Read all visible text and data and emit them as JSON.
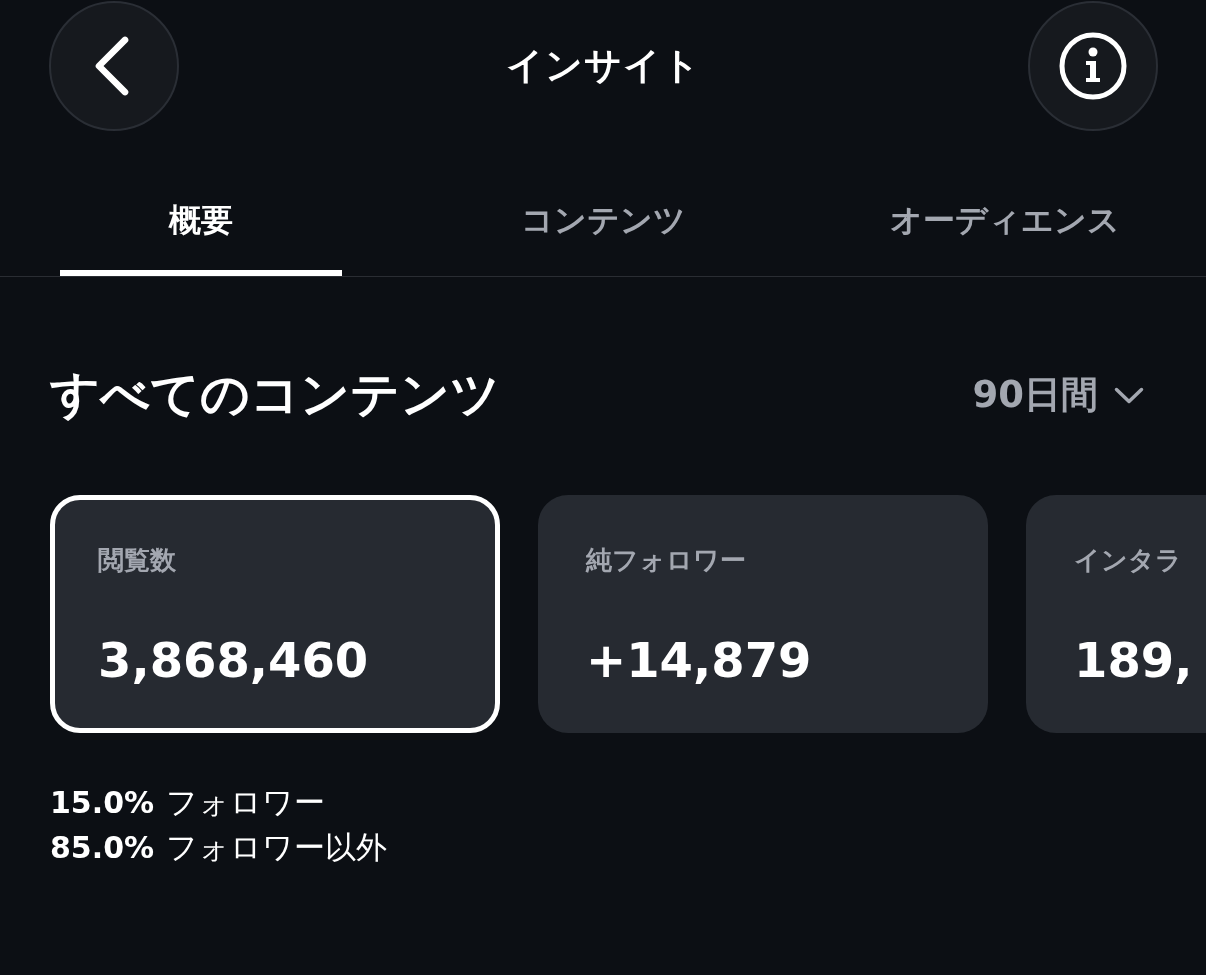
{
  "header": {
    "title": "インサイト"
  },
  "tabs": [
    {
      "label": "概要",
      "selected": true
    },
    {
      "label": "コンテンツ",
      "selected": false
    },
    {
      "label": "オーディエンス",
      "selected": false
    }
  ],
  "section": {
    "title": "すべてのコンテンツ",
    "period": "90日間"
  },
  "metrics": [
    {
      "label": "閲覧数",
      "value": "3,868,460",
      "selected": true
    },
    {
      "label": "純フォロワー",
      "value": "+14,879",
      "selected": false
    },
    {
      "label": "インタラ",
      "value": "189,",
      "selected": false
    }
  ],
  "breakdown": [
    {
      "percent": "15.0%",
      "label": "フォロワー"
    },
    {
      "percent": "85.0%",
      "label": "フォロワー以外"
    }
  ]
}
